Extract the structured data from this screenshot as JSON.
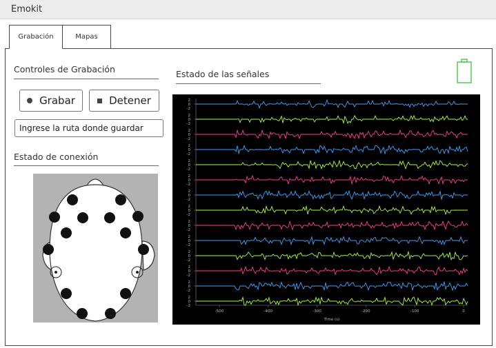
{
  "app": {
    "title": "Emokit"
  },
  "tabs": [
    {
      "label": "Grabación",
      "active": true
    },
    {
      "label": "Mapas",
      "active": false
    }
  ],
  "controls": {
    "heading": "Controles de Grabación",
    "record_label": "Grabar",
    "stop_label": "Detener",
    "path_placeholder": "Ingrese la ruta donde guardar"
  },
  "connection": {
    "heading": "Estado de conexión",
    "sensor_color": "#111111",
    "reference_count": 2
  },
  "signals": {
    "heading": "Estado de las señales",
    "battery_color": "#55cc55",
    "channel_ticks": [
      "2",
      "0",
      "-2"
    ],
    "channel_colors": [
      "#3da5ff",
      "#a8ff3d",
      "#ff3d9e",
      "#3da5ff",
      "#a8ff3d",
      "#ff3d9e",
      "#3da5ff",
      "#a8ff3d",
      "#ff3d9e",
      "#3da5ff",
      "#a8ff3d",
      "#ff3d9e",
      "#3da5ff",
      "#a8ff3d"
    ],
    "x_ticks": [
      "-500",
      "-400",
      "-300",
      "-200",
      "-100",
      "0"
    ],
    "x_label": "Time (s)"
  }
}
